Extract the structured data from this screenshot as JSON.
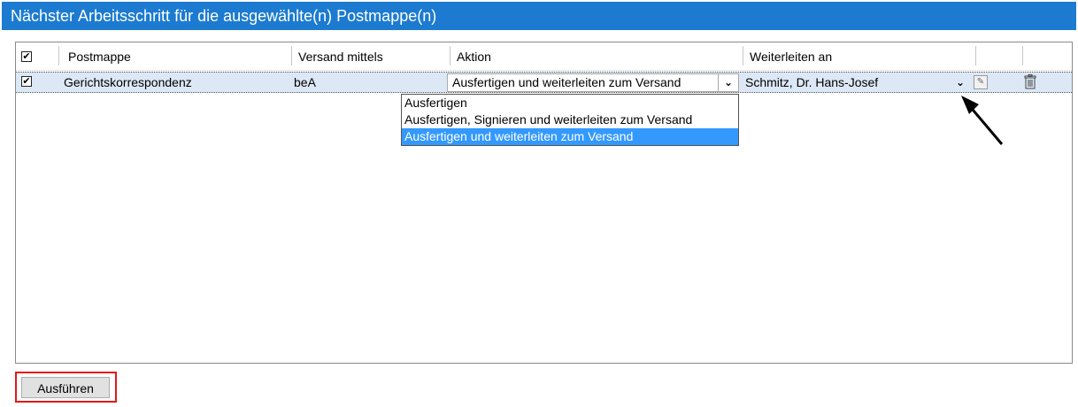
{
  "window": {
    "title": "Nächster Arbeitsschritt für die ausgewählte(n) Postmappe(n)"
  },
  "grid": {
    "columns": [
      "Postmappe",
      "Versand mittels",
      "Aktion",
      "Weiterleiten an"
    ],
    "header_checked": true,
    "row": {
      "checked": true,
      "postmappe": "Gerichtskorrespondenz",
      "versand": "beA",
      "aktion": "Ausfertigen und weiterleiten zum Versand",
      "weiterleiten": "Schmitz, Dr. Hans-Josef"
    },
    "aktion_options": [
      "Ausfertigen",
      "Ausfertigen, Signieren und weiterleiten zum Versand",
      "Ausfertigen und weiterleiten zum Versand"
    ],
    "selected_option_index": 2
  },
  "footer": {
    "run_label": "Ausführen"
  },
  "icons": {
    "checkmark": "checkmark-icon",
    "dropdown": "chevron-down-icon",
    "edit": "pencil-icon",
    "delete": "trash-icon",
    "pointer": "arrow-pointer"
  },
  "colors": {
    "title_bar": "#1c7bd0",
    "selection": "#3399ff",
    "row_background": "#dde8f6",
    "highlight": "#e21818"
  }
}
